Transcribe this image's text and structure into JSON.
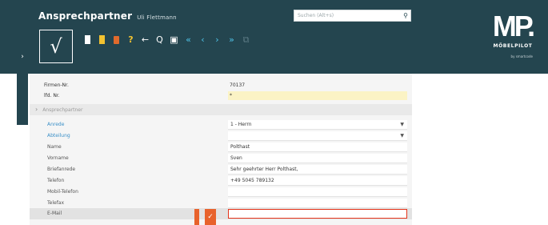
{
  "header": {
    "title": "Ansprechpartner",
    "user": "Uli Flettmann",
    "search_placeholder": "Suchen (Alt+s)"
  },
  "toolbar": {
    "confirm_glyph": "√",
    "buttons": [
      {
        "name": "new-document-icon",
        "glyph": ""
      },
      {
        "name": "copy-document-icon",
        "glyph": ""
      },
      {
        "name": "delete-icon",
        "glyph": ""
      },
      {
        "name": "help-icon",
        "glyph": "?"
      },
      {
        "name": "back-icon",
        "glyph": "←"
      },
      {
        "name": "search-records-icon",
        "glyph": "Q"
      },
      {
        "name": "print-icon",
        "glyph": "▣"
      },
      {
        "name": "first-record-icon",
        "glyph": "«"
      },
      {
        "name": "previous-record-icon",
        "glyph": "‹"
      },
      {
        "name": "next-record-icon",
        "glyph": "›"
      },
      {
        "name": "last-record-icon",
        "glyph": "»"
      },
      {
        "name": "copy-disabled-icon",
        "glyph": "⧉"
      }
    ]
  },
  "logo": {
    "mark": "MP.",
    "name": "MÖBELPILOT",
    "tagline": "by smartcode"
  },
  "form": {
    "firmen_nr_label": "Firmen-Nr.",
    "firmen_nr_value": "70137",
    "lfd_nr_label": "lfd. Nr.",
    "lfd_nr_value": "*",
    "section_label": "Ansprechpartner",
    "fields": [
      {
        "label": "Anrede",
        "value": "1 - Herrn",
        "link": true,
        "dropdown": true
      },
      {
        "label": "Abteilung",
        "value": "",
        "link": true,
        "dropdown": true
      },
      {
        "label": "Name",
        "value": "Polthast",
        "link": false,
        "dropdown": false
      },
      {
        "label": "Vorname",
        "value": "Sven",
        "link": false,
        "dropdown": false
      },
      {
        "label": "Briefanrede",
        "value": "Sehr geehrter Herr Polthast,",
        "link": false,
        "dropdown": false
      },
      {
        "label": "Telefon",
        "value": "+49 5045 789132",
        "link": false,
        "dropdown": false
      },
      {
        "label": "Mobil-Telefon",
        "value": "",
        "link": false,
        "dropdown": false
      },
      {
        "label": "Telefax",
        "value": "",
        "link": false,
        "dropdown": false
      },
      {
        "label": "E-Mail",
        "value": "",
        "link": false,
        "dropdown": false
      }
    ]
  },
  "colors": {
    "header": "#24454f",
    "accent": "#e5341b",
    "link": "#3a8fc7"
  }
}
